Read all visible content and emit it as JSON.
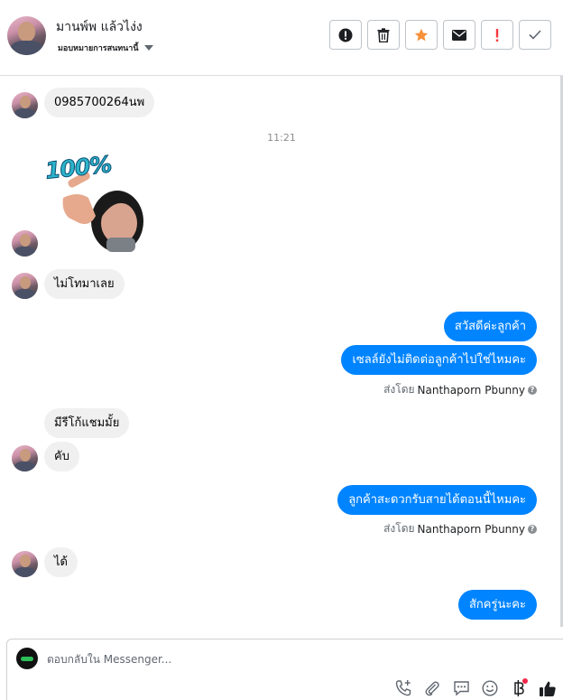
{
  "header": {
    "contact_name": "มานพ์พ แล้วไง่ง",
    "assign_label": "มอบหมายการสนทนานี้",
    "actions": {
      "spam": "exclamation-circle-icon",
      "delete": "trash-icon",
      "star": "star-icon",
      "mark_unread": "envelope-icon",
      "follow_up": "exclamation-icon",
      "done": "check-icon"
    },
    "colors": {
      "star": "#f7923b",
      "follow_up": "#fa383e"
    }
  },
  "messages": [
    {
      "from": "customer",
      "type": "text",
      "text": "0985700264นพ"
    },
    {
      "type": "timestamp",
      "text": "11:21"
    },
    {
      "from": "customer",
      "type": "sticker",
      "text": "100%"
    },
    {
      "from": "customer",
      "type": "text",
      "text": "ไม่โทมาเลย"
    },
    {
      "from": "page",
      "type": "text",
      "text": "สวัสดีค่ะลูกค้า"
    },
    {
      "from": "page",
      "type": "text",
      "text": "เซลล์ยังไม่ติดต่อลูกค้าไปใช่ไหมคะ"
    },
    {
      "type": "sent_by",
      "label": "ส่งโดย",
      "name": "Nanthaporn Pbunny"
    },
    {
      "from": "customer",
      "type": "text",
      "text": "มีรีโก้แชมมั้ย"
    },
    {
      "from": "customer",
      "type": "text",
      "text": "คับ"
    },
    {
      "from": "page",
      "type": "text",
      "text": "ลูกค้าสะดวกรับสายได้ตอนนี้ไหมคะ"
    },
    {
      "type": "sent_by",
      "label": "ส่งโดย",
      "name": "Nanthaporn Pbunny"
    },
    {
      "from": "customer",
      "type": "text",
      "text": "ได้"
    },
    {
      "from": "page",
      "type": "text",
      "text": "สักครู่นะคะ"
    }
  ],
  "composer": {
    "placeholder": "ตอบกลับใน Messenger...",
    "icons": [
      "phone-plus-icon",
      "paperclip-icon",
      "saved-replies-icon",
      "emoji-icon",
      "baht-payment-icon",
      "thumbs-up-icon"
    ],
    "accent_color": "#0084ff",
    "badge_color": "#f02849"
  }
}
